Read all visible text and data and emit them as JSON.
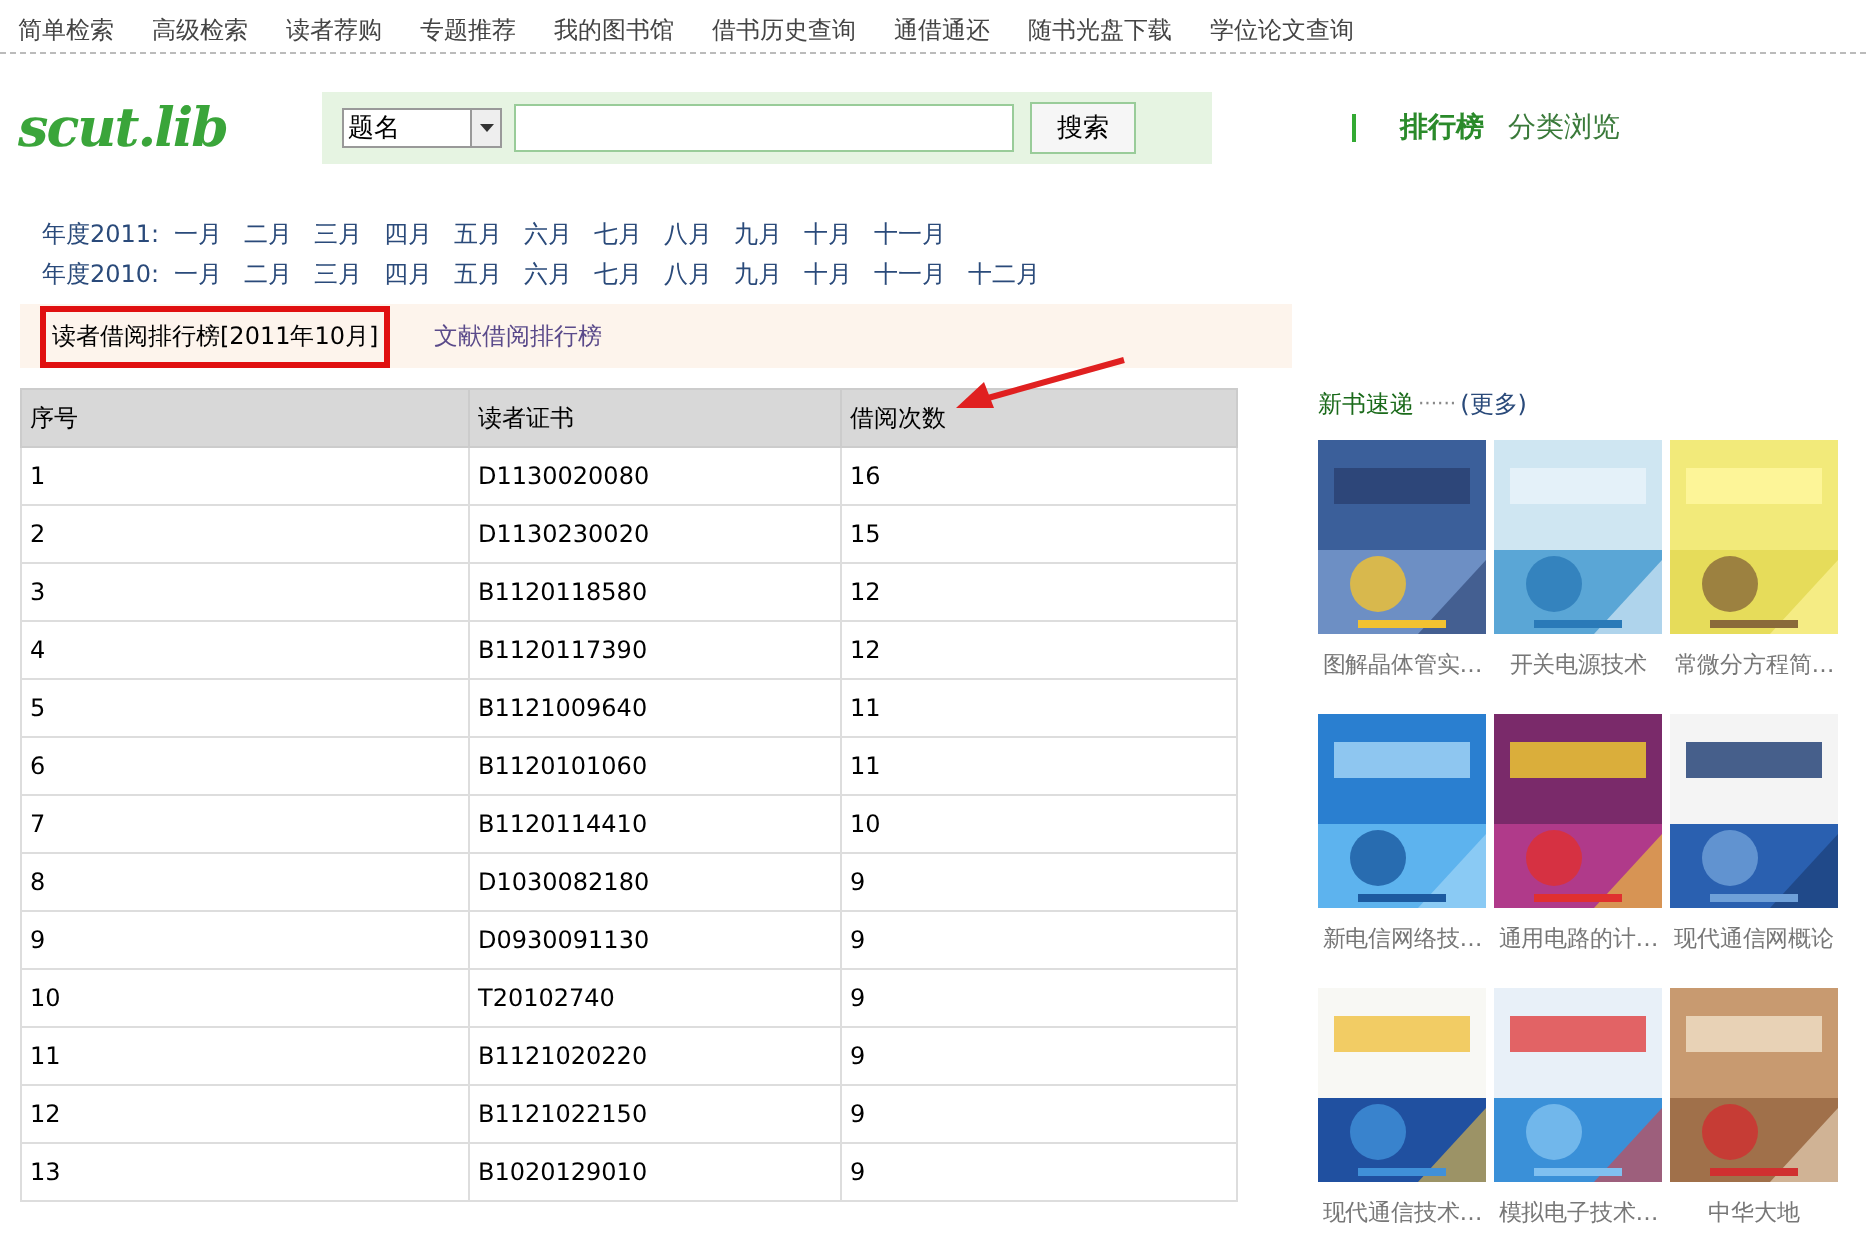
{
  "top_nav": [
    "简单检索",
    "高级检索",
    "读者荐购",
    "专题推荐",
    "我的图书馆",
    "借书历史查询",
    "通借通还",
    "随书光盘下载",
    "学位论文查询"
  ],
  "logo": "scut.lib",
  "search": {
    "field_select": "题名",
    "button": "搜索"
  },
  "right_nav": [
    {
      "label": "排行榜",
      "selected": true
    },
    {
      "label": "分类浏览",
      "selected": false
    }
  ],
  "years": [
    {
      "label": "年度2011:",
      "months": [
        "一月",
        "二月",
        "三月",
        "四月",
        "五月",
        "六月",
        "七月",
        "八月",
        "九月",
        "十月",
        "十一月"
      ]
    },
    {
      "label": "年度2010:",
      "months": [
        "一月",
        "二月",
        "三月",
        "四月",
        "五月",
        "六月",
        "七月",
        "八月",
        "九月",
        "十月",
        "十一月",
        "十二月"
      ]
    }
  ],
  "tabs": [
    {
      "label": "读者借阅排行榜[2011年10月]",
      "selected": true
    },
    {
      "label": "文献借阅排行榜",
      "selected": false
    }
  ],
  "table": {
    "columns": [
      "序号",
      "读者证书",
      "借阅次数"
    ],
    "rows": [
      [
        "1",
        "D1130020080",
        "16"
      ],
      [
        "2",
        "D1130230020",
        "15"
      ],
      [
        "3",
        "B1120118580",
        "12"
      ],
      [
        "4",
        "B1120117390",
        "12"
      ],
      [
        "5",
        "B1121009640",
        "11"
      ],
      [
        "6",
        "B1120101060",
        "11"
      ],
      [
        "7",
        "B1120114410",
        "10"
      ],
      [
        "8",
        "D1030082180",
        "9"
      ],
      [
        "9",
        "D0930091130",
        "9"
      ],
      [
        "10",
        "T20102740",
        "9"
      ],
      [
        "11",
        "B1121020220",
        "9"
      ],
      [
        "12",
        "B1121022150",
        "9"
      ],
      [
        "13",
        "B1020129010",
        "9"
      ]
    ]
  },
  "new_books": {
    "title": "新书速递",
    "dots": "······",
    "more": "(更多)",
    "books": [
      {
        "caption": "图解晶体管实…",
        "kind": "picture"
      },
      {
        "caption": "开关电源技术",
        "kind": "picture"
      },
      {
        "caption": "常微分方程简…",
        "kind": "picture"
      },
      {
        "caption": "新电信网络技…",
        "kind": "picture"
      },
      {
        "caption": "通用电路的计…",
        "kind": "picture"
      },
      {
        "caption": "现代通信网概论",
        "kind": "picture"
      },
      {
        "caption": "现代通信技术…",
        "kind": "picture"
      },
      {
        "caption": "模拟电子技术…",
        "kind": "picture"
      },
      {
        "caption": "中华大地",
        "kind": "picture"
      }
    ]
  }
}
